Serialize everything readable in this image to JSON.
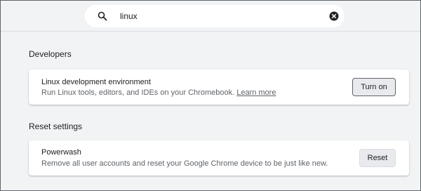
{
  "search": {
    "value": "linux",
    "icon": "search-icon",
    "clear_icon": "clear-icon"
  },
  "developers": {
    "heading": "Developers",
    "linux_env": {
      "title": "Linux development environment",
      "description": "Run Linux tools, editors, and IDEs on your Chromebook.",
      "learn_more": "Learn more",
      "button_label": "Turn on"
    }
  },
  "reset": {
    "heading": "Reset settings",
    "powerwash": {
      "title": "Powerwash",
      "description": "Remove all user accounts and reset your Google Chrome device to be just like new.",
      "button_label": "Reset"
    }
  }
}
